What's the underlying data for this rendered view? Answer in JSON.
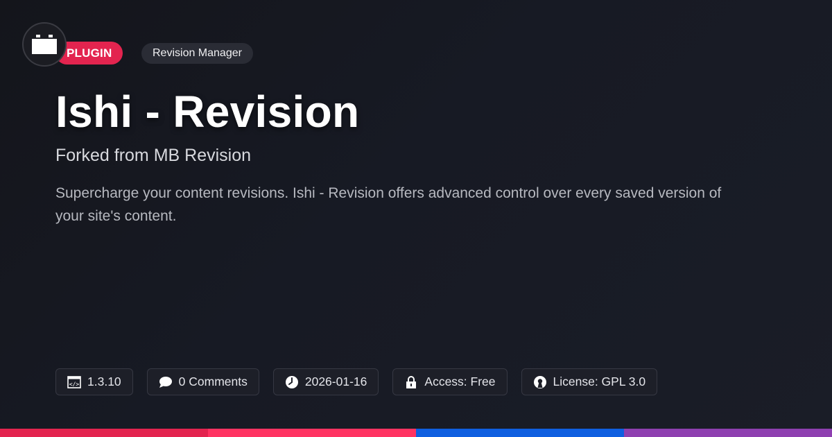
{
  "badges": {
    "type_label": "PLUGIN",
    "category_label": "Revision Manager"
  },
  "header": {
    "title": "Ishi - Revision",
    "subtitle": "Forked from MB Revision",
    "description": "Supercharge your content revisions. Ishi - Revision offers advanced control over every saved version of your site's content."
  },
  "meta": {
    "version": "1.3.10",
    "comments": "0 Comments",
    "date": "2026-01-16",
    "access": "Access: Free",
    "license": "License: GPL 3.0"
  },
  "icons": {
    "logo": "plugin-block-icon",
    "version": "code-icon",
    "comments": "speech-bubble-icon",
    "date": "clock-icon",
    "access": "lock-icon",
    "license": "open-source-icon"
  },
  "colors": {
    "accent": "#e3244f",
    "bar": [
      "#e3244f",
      "#ff3362",
      "#0f5fe0",
      "#8e3fb0"
    ]
  }
}
